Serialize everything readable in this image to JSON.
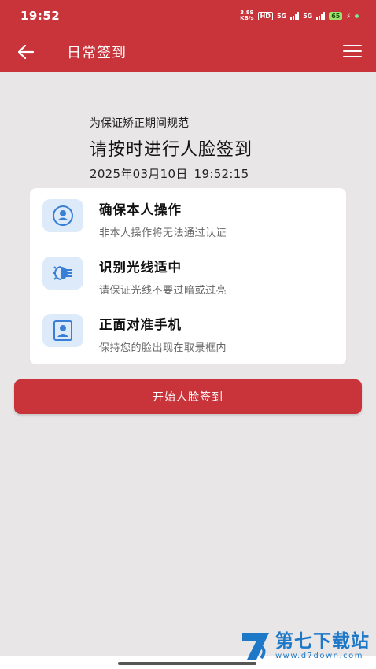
{
  "status_bar": {
    "time": "19:52",
    "speed_value": "3.89",
    "speed_unit": "KB/s",
    "hd": "HD",
    "signal_1": "5G",
    "signal_2": "5G",
    "battery": "65"
  },
  "header": {
    "title": "日常签到"
  },
  "intro": {
    "subtitle": "为保证矫正期间规范",
    "title": "请按时进行人脸签到",
    "date": "2025年03月10日",
    "time": "19:52:15"
  },
  "tips": [
    {
      "title": "确保本人操作",
      "desc": "非本人操作将无法通过认证",
      "icon": "person-circle-icon"
    },
    {
      "title": "识别光线适中",
      "desc": "请保证光线不要过暗或过亮",
      "icon": "light-bulb-icon"
    },
    {
      "title": "正面对准手机",
      "desc": "保持您的脸出现在取景框内",
      "icon": "portrait-frame-icon"
    }
  ],
  "start_button": {
    "label": "开始人脸签到"
  },
  "watermark": {
    "name": "第七下载站",
    "url": "www.d7down.com"
  },
  "colors": {
    "accent": "#c9333a",
    "icon_bg": "#ddeafa",
    "icon_blue": "#3a7fd6",
    "page_bg": "#e8e6e7"
  }
}
